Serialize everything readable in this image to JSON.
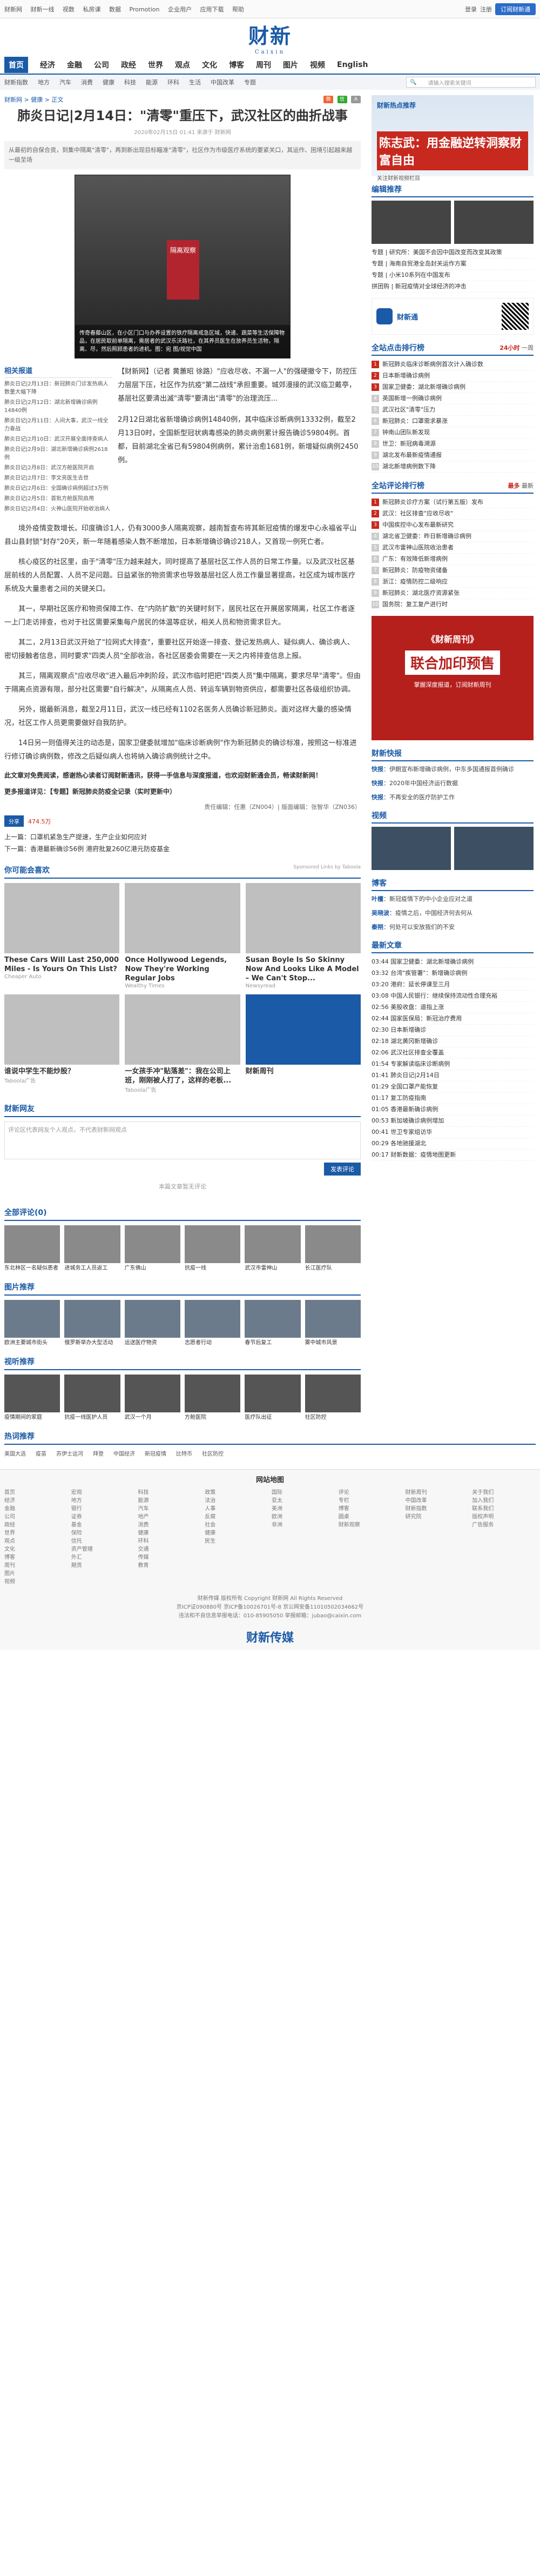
{
  "topbar": {
    "links": [
      "财新网",
      "财新一线",
      "视数",
      "私房课",
      "数据",
      "Promotion",
      "企业用户",
      "应用下载",
      "帮助"
    ],
    "login": "登录",
    "register": "注册",
    "subscribe": "订阅财新通"
  },
  "brand": {
    "logo": "财新",
    "sub": "Caixin"
  },
  "nav1": [
    "首页",
    "经济",
    "金融",
    "公司",
    "政经",
    "世界",
    "观点",
    "文化",
    "博客",
    "周刊",
    "图片",
    "视频",
    "English"
  ],
  "nav2": [
    "财新指数",
    "地方",
    "汽车",
    "消费",
    "健康",
    "科技",
    "能源",
    "环科",
    "生活",
    "中国改革",
    "专题"
  ],
  "search_placeholder": "请输入搜索关键词",
  "crumb": {
    "path": "财新网 > 健康 > 正文"
  },
  "article": {
    "title": "肺炎日记|2月14日：\"清零\"重压下，武汉社区的曲折战事",
    "meta": "2020年02月15日 01:41  来源于 财新网",
    "summary": "从最初的自保合资，到集中隔离\"清零\"，再到新出现目标瞄准\"清零\"，社区作为市级医疗系统的要紧关口，其运作、困境引起越来越一级至场",
    "photo_sign": "隔离观察",
    "photo_caption": "传奇春藤山区，在小区门口与办养设置的铁疗隔离戒急区域，快递、蔬菜等生活保障物品，在居民取前单隔离，需居者的武汉乐沃路社，在其养员医生在放养员生活物，隔离、尽，然后照顾患者的进机。图：宛 图/视觉中国",
    "lede": "【财新网】（记者 黄蕙昭 徐路）\"应收尽收、不漏一人\"的强硬撤令下，防控压力层层下压，社区作为抗疫\"第二战线\"承担重要。城郊漫接的武汉临卫戴亭，基层社区要清出滅\"清零\"要清出\"清零\"的治理流压...",
    "lede2": "2月12日湖北省新增确诊病例14840例，其中临床诊断病例13332例，截至2月13日0时，全国新型冠状病毒感染的肺炎病例累计报告确诊59804例。首都，目前湖北全省已有59804例病例，累计治愈1681例，新增疑似病例2450例。",
    "paras": [
      "境外疫情变数增长。印度确诊1人，仍有3000多人隔离观察，越南暂查布将其新冠疫情的爆发中心永福省平山县山县封锁\"封存\"20天，新一年随着感染人数不断增加，日本新增确诊确诊218人，又首现一例死亡者。",
      "核心疫区的社区里，由于\"清零\"压力越来越大，同时提高了基层社区工作人员的日常工作量。以及武汉社区基层前线的人员配置、人员不足问题。日益紧张的物资需求也导致基层社区人员工作量显著提高，社区成为城市医疗系统及大量患者之间的关键关口。",
      "其一，早期社区医疗和物资保障工作、在\"内防扩散\"的关键时刻下，居民社区在开展居家隔离，社区工作者逐一上门走访排查，也对于社区需要采集每户居民的体温等症状，相关人员和物资需求巨大。",
      "其二，2月13日武汉开始了\"拉网式大排查\"，重要社区开始逐一排查、登记发热病人、疑似病人、确诊病人、密切接触者信息，同时要求\"四类人员\"全部收治，各社区居委会需要在一天之内将排查信息上报。",
      "其三，隔离观察点\"应收尽收\"进入最后冲刺阶段，武汉市临时把把\"四类人员\"集中隔离，要求尽早\"清零\"。但由于隔离点资源有限，部分社区需要\"自行解决\"，从隔离点人员、转运车辆到物资供应，都需要社区各级组织协调。",
      "另外，据最新消息，截至2月11日，武汉一线已经有1102名医务人员确诊新冠肺炎。面对这样大量的感染情况，社区工作人员更需要做好自我防护。",
      "14日另一则值得关注的动态是，国家卫健委就增加\"临床诊断病例\"作为新冠肺炎的确诊标准，按照这一标准进行修订确诊病例数，修改之后疑似病人也将纳入确诊病例统计之中。"
    ],
    "bold_note": "此文章对免费阅读，感谢热心读者订阅财新通讯，获得一手信息与深度报道，也欢迎财新通会员，畅读财新网！",
    "more": "更多报道详见：【专题】新冠肺炎防疫全记录（实时更新中）",
    "editor": "责任编辑：任惠（ZN004）| 版面编辑：张智华（ZN036）",
    "like_count": "474.5万",
    "prev": "上一篇：口罩机紧急生产提速，生产企业如何应对",
    "next": "下一篇：香港最新确诊56例 港府批复260亿港元防疫基金"
  },
  "related": {
    "title": "相关报道",
    "items": [
      "肺炎日记|2月13日：新冠肺炎门诊发热病人数量大幅下降",
      "肺炎日记|2月12日：湖北新增确诊病例14840例",
      "肺炎日记|2月11日：人间大事，武汉一线全力奋战",
      "肺炎日记|2月10日：武汉开展全面排查病人",
      "肺炎日记|2月9日：湖北新增确诊病例2618例",
      "肺炎日记|2月8日：武汉方舱医院开启",
      "肺炎日记|2月7日：李文亮医生去世",
      "肺炎日记|2月6日：全国确诊病例超过3万例",
      "肺炎日记|2月5日：首批方舱医院启用",
      "肺炎日记|2月4日：火神山医院开始收治病人"
    ]
  },
  "ads": {
    "title": "你可能会喜欢",
    "sponsor": "Sponsored Links by Taboola",
    "cards": [
      {
        "title": "These Cars Will Last 250,000 Miles - Is Yours On This List?",
        "src": "Cheaper Auto"
      },
      {
        "title": "Once Hollywood Legends, Now They're Working Regular Jobs",
        "src": "Wealthy Times"
      },
      {
        "title": "Susan Boyle Is So Skinny Now And Looks Like A Model – We Can't Stop...",
        "src": "Newsyread"
      },
      {
        "title": "谁说中学生不能炒股？",
        "src": "Taboola广告"
      },
      {
        "title": "一女孩手冲\"贴落差\"：我在公司上班，刚刚被人打了，这样的老板...",
        "src": "Taboola广告"
      },
      {
        "title": "财新周刊",
        "src": ""
      }
    ]
  },
  "comments": {
    "title": "财新网友",
    "placeholder": "评论区代表网友个人观点，不代表财新网观点",
    "post": "发表评论",
    "empty": "本篇文章暂无评论"
  },
  "more_news": {
    "title": "全部评论(0)",
    "items": [
      "东北林区一名疑似患者",
      "进城务工人员返工",
      "广东佛山",
      "抗疫一线",
      "武汉市雷神山",
      "长江医疗队"
    ]
  },
  "pic_news": {
    "title": "图片推荐",
    "items": [
      "欧洲主要城市街头",
      "俄罗斯举办大型活动",
      "运送医疗物资",
      "志愿者行动",
      "春节后复工",
      "雾中城市风景"
    ]
  },
  "video_news": {
    "title": "视听推荐",
    "items": [
      "疫情期间的家庭",
      "抗疫一线医护人员",
      "武汉一个月",
      "方舱医院",
      "医疗队出征",
      "社区防控"
    ]
  },
  "hot_links": {
    "title": "热词推荐",
    "items": [
      "美国大选",
      "疫苗",
      "苏伊士运河",
      "拜登",
      "中国经济",
      "新冠疫情",
      "比特币",
      "社区防控"
    ]
  },
  "side": {
    "ad1_top": "财新热点推荐",
    "ad1_name": "陈志武：用金融逆转洞察财富自由",
    "ad1_small": "关注财新视频栏目",
    "editor_pick": "编辑推荐",
    "editor_items": [
      "专题 | 研究所：美国不会因中国改变而改变其政策",
      "专题 | 海南自贸港全岛封关运作方案",
      "专题 | 小米10系列在中国发布",
      "拼团购 | 新冠疫情对全球经济的冲击"
    ],
    "app_label": "财新通",
    "rank_title": "全站点击排行榜",
    "rank_tabs": [
      "24小时",
      "一周"
    ],
    "rank_items": [
      "新冠肺炎临床诊断病例首次计入确诊数",
      "日本新增确诊病例",
      "国家卫健委：湖北新增确诊病例",
      "英国新增一例确诊病例",
      "武汉社区\"清零\"压力",
      "新冠肺炎：口罩需求暴涨",
      "钟南山团队新发现",
      "世卫：新冠病毒溯源",
      "湖北发布最新疫情通报",
      "湖北新增病例数下降"
    ],
    "comment_title": "全站评论排行榜",
    "comment_tabs": [
      "最多",
      "最新"
    ],
    "comment_items": [
      "新冠肺炎诊疗方案（试行第五版）发布",
      "武汉：社区排查\"应收尽收\"",
      "中国疾控中心发布最新研究",
      "湖北省卫健委：昨日新增确诊病例",
      "武汉市雷神山医院收治患者",
      "广东：有效降低新增病例",
      "新冠肺炎：防疫物资储备",
      "浙江：疫情防控二级响应",
      "新冠肺炎：湖北医疗资源紧张",
      "国务院：复工复产进行时"
    ],
    "bigad_t1": "《财新周刊》",
    "bigad_t2": "联合加印预售",
    "bigad_t3": "掌握深度报道，订阅财新周刊",
    "news_title": "财新快报",
    "brief_items": [
      {
        "tag": "快报",
        "text": "伊朗宣布新增确诊病例，中东多国通报首例确诊"
      },
      {
        "tag": "快报",
        "text": "2020年中国经济运行数据"
      },
      {
        "tag": "快报",
        "text": "不再安全的医疗防护工作"
      }
    ],
    "video_title": "视频",
    "blog_title": "博客",
    "blog_items": [
      {
        "tag": "叶檀",
        "text": "新冠疫情下的中小企业应对之道"
      },
      {
        "tag": "吴晓波",
        "text": "疫情之后，中国经济何去何从"
      },
      {
        "tag": "秦朔",
        "text": "何处可以安放我们的不安"
      }
    ],
    "latest_title": "最新文章",
    "latest_items": [
      "03:44 国家卫健委：湖北新增确诊病例",
      "03:32 台湾\"疾管署\"：新增确诊病例",
      "03:20 港府：延长停课至三月",
      "03:08 中国人民银行：继续保持流动性合理充裕",
      "02:56 美股收盘：道指上涨",
      "02:44 国家医保局：新冠治疗费用",
      "02:30 日本新增确诊",
      "02:18 湖北黄冈新增确诊",
      "02:06 武汉社区排查全覆盖",
      "01:54 专家解读临床诊断病例",
      "01:41 肺炎日记|2月14日",
      "01:29 全国口罩产能恢复",
      "01:17 复工防疫指南",
      "01:05 香港最新确诊病例",
      "00:53 新加坡确诊病例增加",
      "00:41 世卫专家组访华",
      "00:29 各地驰援湖北",
      "00:17 财新数据：疫情地图更新"
    ]
  },
  "footer": {
    "title": "网站地图",
    "cols": [
      [
        "首页",
        "经济",
        "金融",
        "公司",
        "政经",
        "世界",
        "观点",
        "文化",
        "博客",
        "周刊",
        "图片",
        "视频"
      ],
      [
        "宏观",
        "地方",
        "银行",
        "证券",
        "基金",
        "保险",
        "信托",
        "资产管理",
        "外汇",
        "期货"
      ],
      [
        "科技",
        "能源",
        "汽车",
        "地产",
        "消费",
        "健康",
        "环科",
        "交通",
        "传媒",
        "教育"
      ],
      [
        "政策",
        "法治",
        "人事",
        "反腐",
        "社会",
        "健康",
        "民生"
      ],
      [
        "国际",
        "亚太",
        "美洲",
        "欧洲",
        "非洲"
      ],
      [
        "评论",
        "专栏",
        "博客",
        "圆桌",
        "财新观察"
      ],
      [
        "财新周刊",
        "中国改革",
        "财新指数",
        "研究院"
      ],
      [
        "关于我们",
        "加入我们",
        "联系我们",
        "版权声明",
        "广告服务"
      ]
    ],
    "copy1": "财新传媒 版权所有 Copyright 财新网 All Rights Reserved",
    "copy2": "京ICP证090880号 京ICP备10026701号-8 京公网安备11010502034662号",
    "copy3": "违法和不良信息举报电话：010-85905050 举报邮箱：jubao@caixin.com",
    "bottom_logo": "财新传媒"
  }
}
